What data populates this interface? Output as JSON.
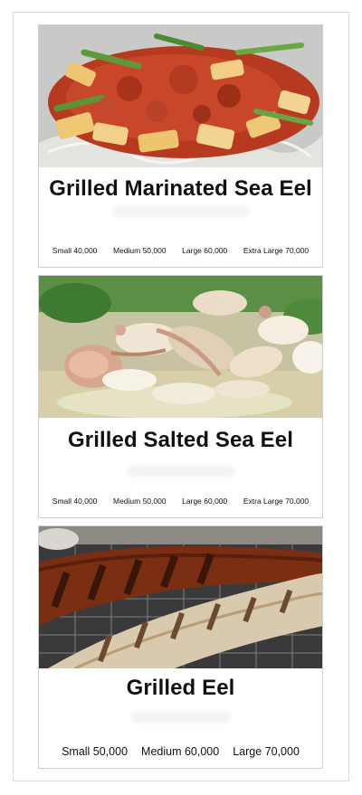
{
  "menu": {
    "items": [
      {
        "name": "Grilled Marinated Sea Eel",
        "prices": [
          "Small 40,000",
          "Medium 50,000",
          "Large 60,000",
          "Extra Large 70,000"
        ]
      },
      {
        "name": "Grilled Salted Sea Eel",
        "prices": [
          "Small 40,000",
          "Medium 50,000",
          "Large 60,000",
          "Extra Large 70,000"
        ]
      },
      {
        "name": "Grilled Eel",
        "prices": [
          "Small 50,000",
          "Medium 60,000",
          "Large 70,000"
        ]
      }
    ]
  }
}
